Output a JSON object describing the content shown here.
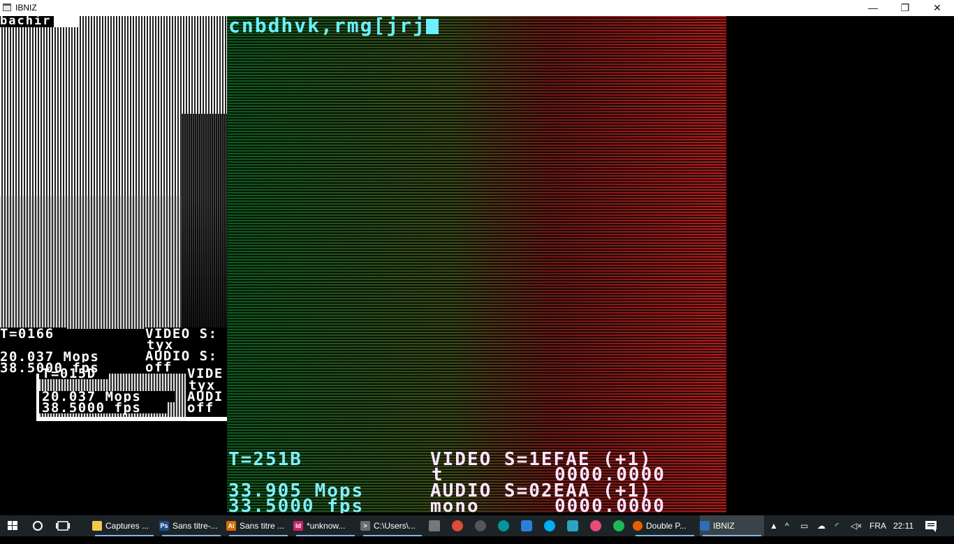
{
  "window": {
    "title": "IBNIZ",
    "minimize_glyph": "—",
    "maximize_glyph": "❐",
    "close_glyph": "✕"
  },
  "left_panel": {
    "name_tag": "bachir",
    "stats": {
      "t": "T=0166",
      "mops": "20.037 Mops",
      "fps": "38.5000 fps",
      "video": "VIDEO S:",
      "video_mode": "tyx",
      "audio": "AUDIO S:",
      "audio_mode": "off"
    },
    "nested": {
      "t": "T=015D",
      "video": "VIDE",
      "video_mode": "tyx",
      "mops": "20.037 Mops",
      "audio": "AUDI",
      "fps": "38.5000 fps",
      "audio_mode": "off"
    }
  },
  "editor": {
    "code": "cnbdhvk,rmg[jrj"
  },
  "stats": {
    "t": "T=251B",
    "mops": "33.905 Mops",
    "fps": "33.5000 fps",
    "video": "VIDEO S=1EFAE (+1)",
    "video_mode": "t",
    "video_time": "0000.0000",
    "audio": "AUDIO S=02EAA (+1)",
    "audio_mode": "mono",
    "audio_time": "0000.0000"
  },
  "taskbar": {
    "tasks": [
      {
        "label": "Captures ...",
        "icon": "folder-icon",
        "color": "#f2c94c"
      },
      {
        "label": "Sans titre-...",
        "icon": "photoshop-icon",
        "color": "#1f4e8c",
        "glyph": "Ps"
      },
      {
        "label": "Sans titre ...",
        "icon": "illustrator-icon",
        "color": "#d86a00",
        "glyph": "Ai"
      },
      {
        "label": "*unknow...",
        "icon": "indesign-icon",
        "color": "#c8266a",
        "glyph": "Id"
      },
      {
        "label": "C:\\Users\\...",
        "icon": "terminal-icon",
        "color": "#6b6b6b",
        "glyph": ">"
      }
    ],
    "pinned": [
      "app-icon",
      "chrome-icon",
      "bluetooth-icon",
      "arduino-icon",
      "photo-icon",
      "skype-icon",
      "app-icon",
      "itunes-icon",
      "spotify-icon"
    ],
    "firefox_task": "Double P...",
    "active_task": "IBNIZ",
    "lang": "FRA",
    "clock": "22:11"
  }
}
